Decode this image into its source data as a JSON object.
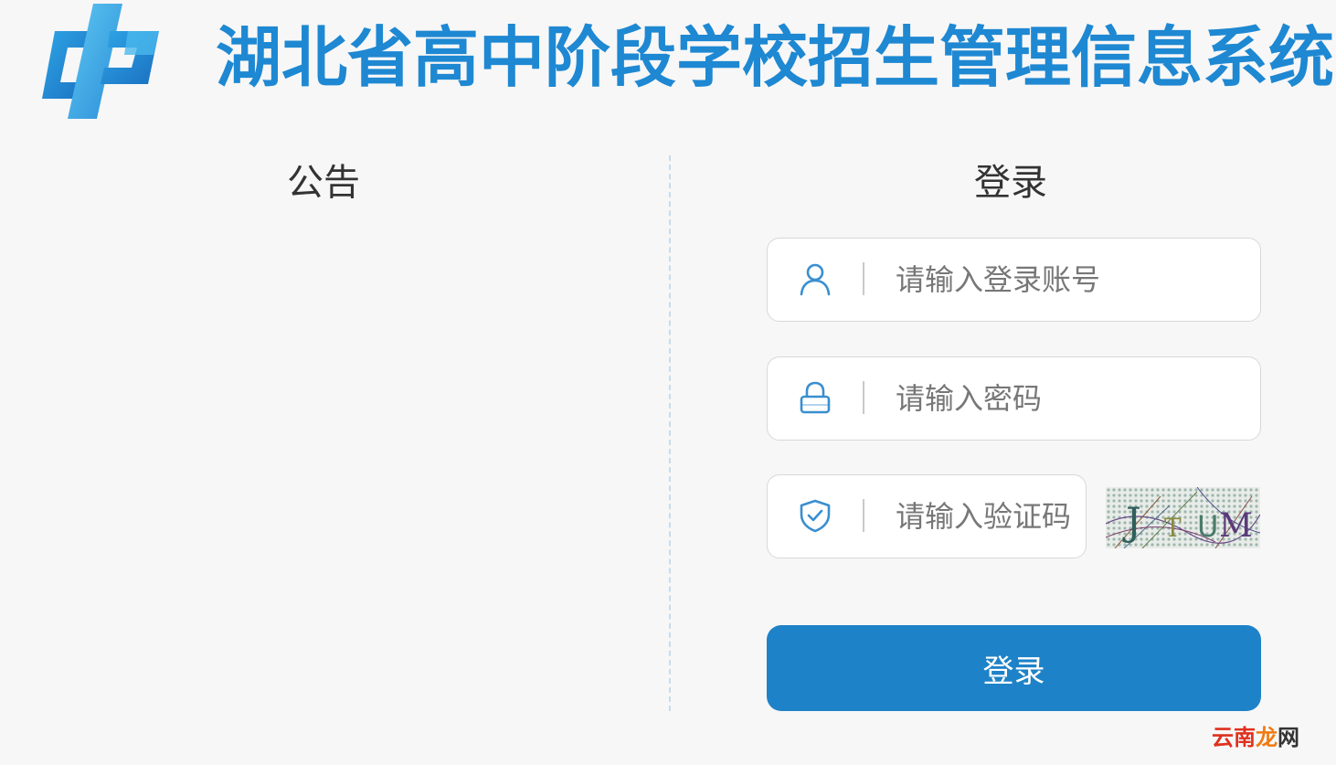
{
  "header": {
    "title": "湖北省高中阶段学校招生管理信息系统",
    "logo_icon": "logo-icon"
  },
  "notice": {
    "title": "公告"
  },
  "login": {
    "title": "登录",
    "account": {
      "placeholder": "请输入登录账号",
      "value": "",
      "icon": "user-icon"
    },
    "password": {
      "placeholder": "请输入密码",
      "value": "",
      "icon": "lock-icon"
    },
    "captcha": {
      "placeholder": "请输入验证码",
      "value": "",
      "icon": "shield-check-icon",
      "code_text": "JTUM"
    },
    "submit_label": "登录"
  },
  "watermark": {
    "part1": "云南",
    "part2": "龙",
    "part3": "网"
  },
  "colors": {
    "brand": "#1e88d2",
    "button": "#1e82c8",
    "icon": "#3a8fd0",
    "background": "#f7f7f7"
  }
}
